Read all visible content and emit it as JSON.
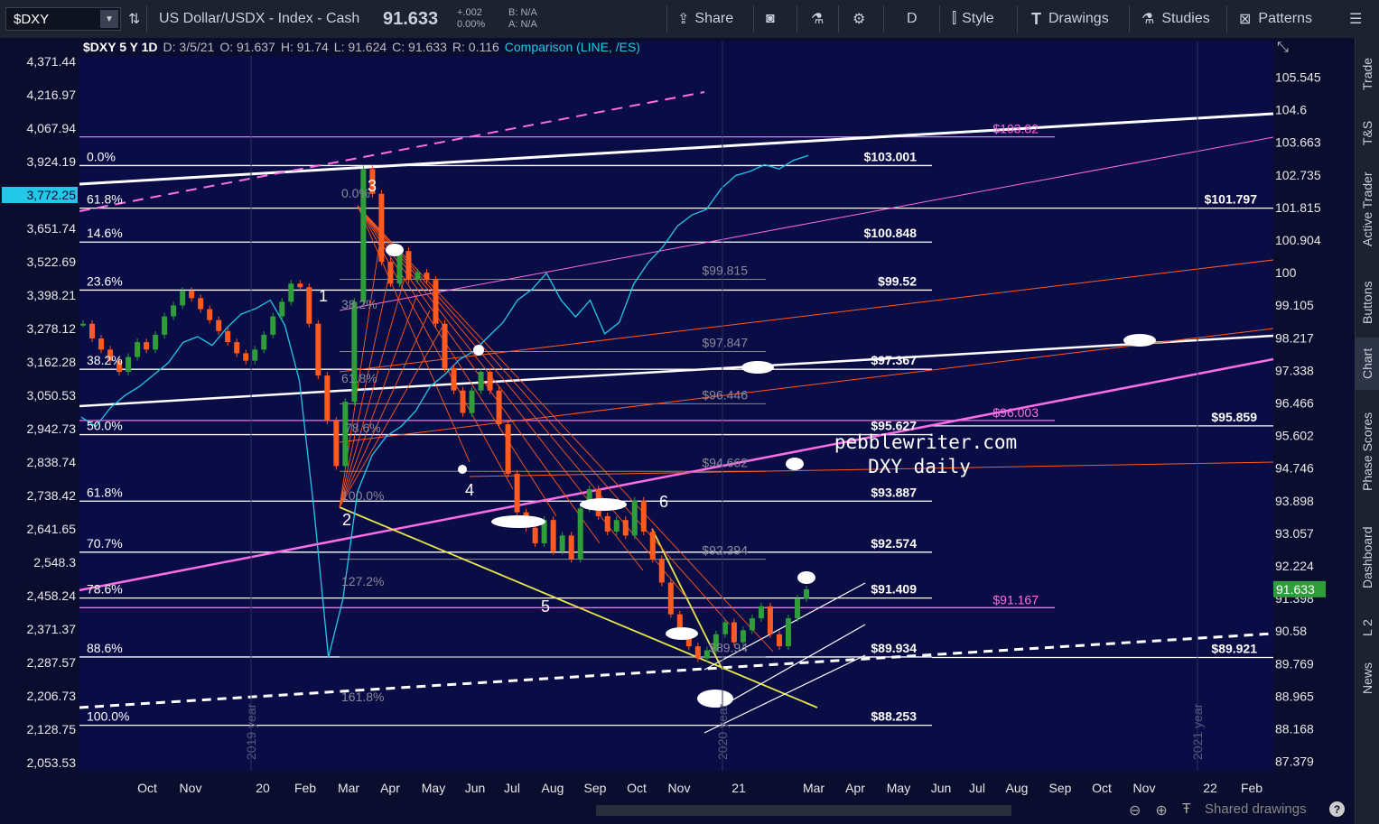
{
  "toolbar": {
    "symbol": "$DXY",
    "description": "US Dollar/USDX - Index - Cash",
    "last": "91.633",
    "change": "+.002",
    "change_pct": "0.00%",
    "bid": "B: N/A",
    "ask": "A: N/A",
    "share": "Share",
    "timeframe": "D",
    "style": "Style",
    "drawings": "Drawings",
    "studies": "Studies",
    "patterns": "Patterns"
  },
  "right_tabs": [
    "Trade",
    "T&S",
    "Active Trader",
    "Buttons",
    "Chart",
    "Phase Scores",
    "Dashboard",
    "L 2",
    "News"
  ],
  "header": {
    "title": "$DXY 5 Y 1D",
    "date": "D: 3/5/21",
    "open": "O: 91.637",
    "high": "H: 91.74",
    "low": "L: 91.624",
    "close": "C: 91.633",
    "range": "R: 0.116",
    "comparison": "Comparison (LINE, /ES)"
  },
  "watermark": {
    "line1": "pebblewriter.com",
    "line2": "DXY daily"
  },
  "bottom": {
    "shared": "Shared drawings"
  },
  "colors": {
    "bg": "#0b0d2e",
    "price_up": "#2e9d3a",
    "price_down": "#ff5a1f",
    "comparison": "#22c8e8",
    "fib": "#ffffff",
    "pink": "#ff6ee6",
    "orange": "#ff5a1f",
    "yellow": "#e8e84a"
  },
  "chart_data": {
    "type": "line",
    "left_axis": {
      "title": "",
      "ticks": [
        "4,371.44",
        "4,216.97",
        "4,067.94",
        "3,924.19",
        "3,772.25",
        "3,651.74",
        "3,522.69",
        "3,398.21",
        "3,278.12",
        "3,162.28",
        "3,050.53",
        "2,942.73",
        "2,838.74",
        "2,738.42",
        "2,641.65",
        "2,548.3",
        "2,458.24",
        "2,371.37",
        "2,287.57",
        "2,206.73",
        "2,128.75",
        "2,053.53"
      ],
      "current": "3,772.25"
    },
    "right_axis": {
      "title": "",
      "ticks": [
        "105.545",
        "104.6",
        "103.663",
        "102.735",
        "101.815",
        "100.904",
        "100",
        "99.105",
        "98.217",
        "97.338",
        "96.466",
        "95.602",
        "94.746",
        "93.898",
        "93.057",
        "92.224",
        "91.398",
        "90.58",
        "89.769",
        "88.965",
        "88.168",
        "87.379"
      ],
      "current": "91.633"
    },
    "x_labels": [
      "Oct",
      "Nov",
      "20",
      "Feb",
      "Mar",
      "Apr",
      "May",
      "Jun",
      "Jul",
      "Aug",
      "Sep",
      "Oct",
      "Nov",
      "21",
      "Mar",
      "Apr",
      "May",
      "Jun",
      "Jul",
      "Aug",
      "Sep",
      "Oct",
      "Nov",
      "22",
      "Feb"
    ],
    "year_markers": [
      "2019 year",
      "2020 year",
      "2021 year"
    ],
    "series": [
      {
        "name": "$DXY",
        "type": "candle",
        "values": [
          98.6,
          98.2,
          97.9,
          97.6,
          97.3,
          97.7,
          98.1,
          97.9,
          98.3,
          98.8,
          99.1,
          99.5,
          99.3,
          99.0,
          98.7,
          98.4,
          98.1,
          97.8,
          97.6,
          97.9,
          98.3,
          98.8,
          99.2,
          99.7,
          99.6,
          98.6,
          97.2,
          96.0,
          94.8,
          96.5,
          99.2,
          102.9,
          102.2,
          100.3,
          99.7,
          100.6,
          99.8,
          100.0,
          99.8,
          98.6,
          97.4,
          96.8,
          96.2,
          96.8,
          97.3,
          96.8,
          95.9,
          94.6,
          93.6,
          93.2,
          92.8,
          93.4,
          92.6,
          93.0,
          92.4,
          93.7,
          94.2,
          93.5,
          93.1,
          93.4,
          93.0,
          93.9,
          93.1,
          92.4,
          91.8,
          91.0,
          90.5,
          90.2,
          89.9,
          90.1,
          90.5,
          90.8,
          90.3,
          90.6,
          90.9,
          91.2,
          90.5,
          90.2,
          90.9,
          91.4,
          91.63
        ]
      },
      {
        "name": "/ES",
        "type": "line",
        "values": [
          2980,
          2950,
          3010,
          3050,
          3080,
          3120,
          3160,
          3230,
          3250,
          3220,
          3280,
          3330,
          3350,
          3380,
          3290,
          3100,
          2700,
          2300,
          2450,
          2750,
          2860,
          2920,
          2950,
          3000,
          3080,
          3120,
          3170,
          3200,
          3250,
          3300,
          3380,
          3420,
          3480,
          3380,
          3320,
          3380,
          3260,
          3300,
          3440,
          3520,
          3580,
          3660,
          3700,
          3720,
          3800,
          3860,
          3880,
          3910,
          3890,
          3930,
          3950
        ]
      }
    ],
    "fib_levels": [
      {
        "label": "0.0%",
        "value": "$103.001"
      },
      {
        "label": "61.8%",
        "value": "$101.797"
      },
      {
        "label": "14.6%",
        "value": "$100.848"
      },
      {
        "label": "23.6%",
        "value": "$99.52"
      },
      {
        "label": "38.2%",
        "value": "$97.367"
      },
      {
        "label": "50.0%",
        "value": "$95.627"
      },
      {
        "label": "61.8%",
        "value": "$93.887"
      },
      {
        "label": "70.7%",
        "value": "$92.574"
      },
      {
        "label": "78.6%",
        "value": "$91.409"
      },
      {
        "label": "88.6%",
        "value": "$89.934"
      },
      {
        "label": "100.0%",
        "value": "$88.253"
      }
    ],
    "secondary_fibs": [
      "$99.815",
      "$97.847",
      "$96.446",
      "$94.662",
      "$92.394",
      "$89.94",
      "38.2%",
      "61.8%",
      "78.6%",
      "100.0%",
      "127.2%",
      "161.8%",
      "0.0%"
    ],
    "pink_levels": [
      "$103.82",
      "$96.003",
      "$91.167"
    ],
    "side_labels": [
      "$101.797",
      "$95.859",
      "$89.921"
    ],
    "wave_labels": [
      "1",
      "2",
      "3",
      "4",
      "5",
      "6"
    ]
  }
}
